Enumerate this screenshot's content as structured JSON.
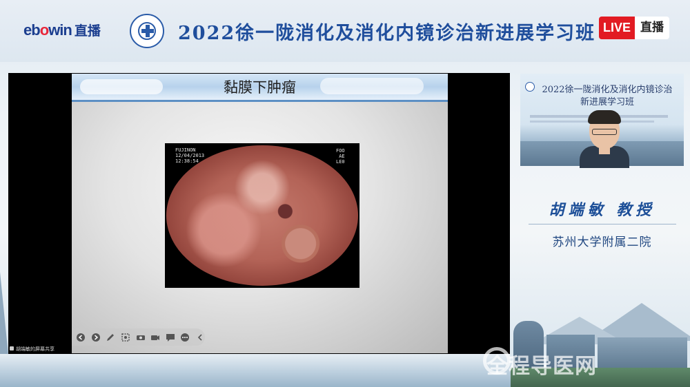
{
  "header": {
    "platform_logo_prefix": "eb",
    "platform_logo_o": "o",
    "platform_logo_suffix": "win",
    "platform_logo_zb": "直播",
    "title": "2022徐一陇消化及消化内镜诊治新进展学习班",
    "live_badge": "LIVE",
    "live_text": "直播"
  },
  "slide": {
    "title": "黏膜下肿瘤",
    "endoscope_overlay_left": "FUJINON\n12/04/2013\n12:38:54",
    "endoscope_overlay_right": "FOO\nAE\nLE0"
  },
  "toolbar": {
    "tools": [
      "prev",
      "next",
      "pen",
      "select",
      "laser",
      "camera",
      "comment",
      "more",
      "collapse"
    ]
  },
  "presenter": {
    "label": "胡端敏的屏幕共享"
  },
  "camera": {
    "background_title": "2022徐一陇消化及消化内镜诊治新进展学习班"
  },
  "speaker": {
    "name": "胡端敏 教授",
    "institution": "苏州大学附属二院"
  },
  "watermark": {
    "text": "全程导医网"
  },
  "colors": {
    "brand_blue": "#1f4e9c",
    "live_red": "#e21b23"
  }
}
